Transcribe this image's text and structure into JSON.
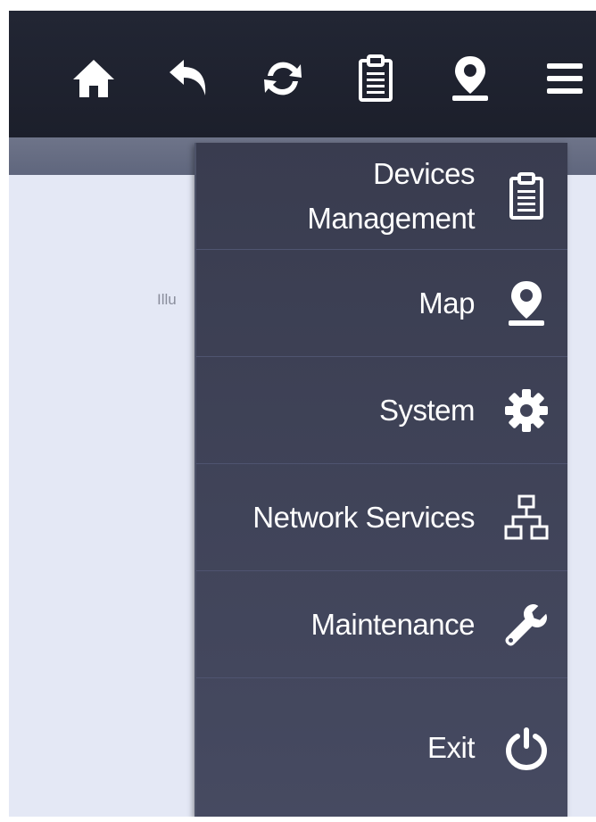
{
  "content": {
    "partial_text": "Illu"
  },
  "topbar": {
    "icons": [
      "home-icon",
      "back-icon",
      "refresh-icon",
      "clipboard-icon",
      "map-marker-icon",
      "hamburger-menu-icon"
    ]
  },
  "menu": {
    "items": [
      {
        "label": "Devices\nManagement",
        "icon": "clipboard-icon"
      },
      {
        "label": "Map",
        "icon": "map-marker-icon"
      },
      {
        "label": "System",
        "icon": "gear-icon"
      },
      {
        "label": "Network Services",
        "icon": "network-icon"
      },
      {
        "label": "Maintenance",
        "icon": "wrench-icon"
      },
      {
        "label": "Exit",
        "icon": "power-icon"
      }
    ]
  },
  "colors": {
    "topbar_bg": "#1f2230",
    "menu_bg": "#3f4358",
    "content_bg": "#e4e8f5",
    "icon": "#ffffff"
  }
}
